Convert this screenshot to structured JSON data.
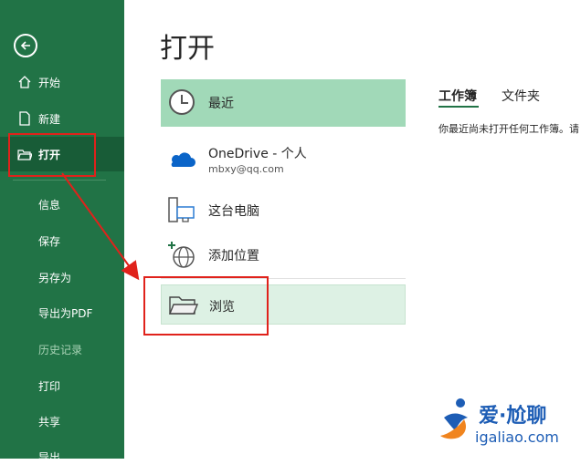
{
  "sidebar": {
    "items": [
      {
        "label": "开始",
        "icon": "home-icon"
      },
      {
        "label": "新建",
        "icon": "new-document-icon"
      },
      {
        "label": "打开",
        "icon": "open-folder-icon"
      }
    ],
    "sub_items": [
      "信息",
      "保存",
      "另存为",
      "导出为PDF",
      "历史记录",
      "打印",
      "共享",
      "导出"
    ],
    "disabled_item": "历史记录"
  },
  "main": {
    "title": "打开",
    "locations": [
      {
        "name": "最近",
        "icon": "clock-icon"
      },
      {
        "name": "OneDrive - 个人",
        "sub": "mbxy@qq.com",
        "icon": "cloud-icon"
      },
      {
        "name": "这台电脑",
        "icon": "computer-icon"
      },
      {
        "name": "添加位置",
        "icon": "add-globe-icon"
      },
      {
        "name": "浏览",
        "icon": "folder-icon"
      }
    ]
  },
  "right_panel": {
    "tabs": [
      "工作簿",
      "文件夹"
    ],
    "empty_message": "你最近尚未打开任何工作簿。请"
  },
  "watermark": {
    "title": "爱·尬聊",
    "url": "igaliao.com"
  },
  "colors": {
    "sidebar_bg": "#217346",
    "selected_bg": "#a1d9b8",
    "annotation_red": "#e0221b"
  }
}
